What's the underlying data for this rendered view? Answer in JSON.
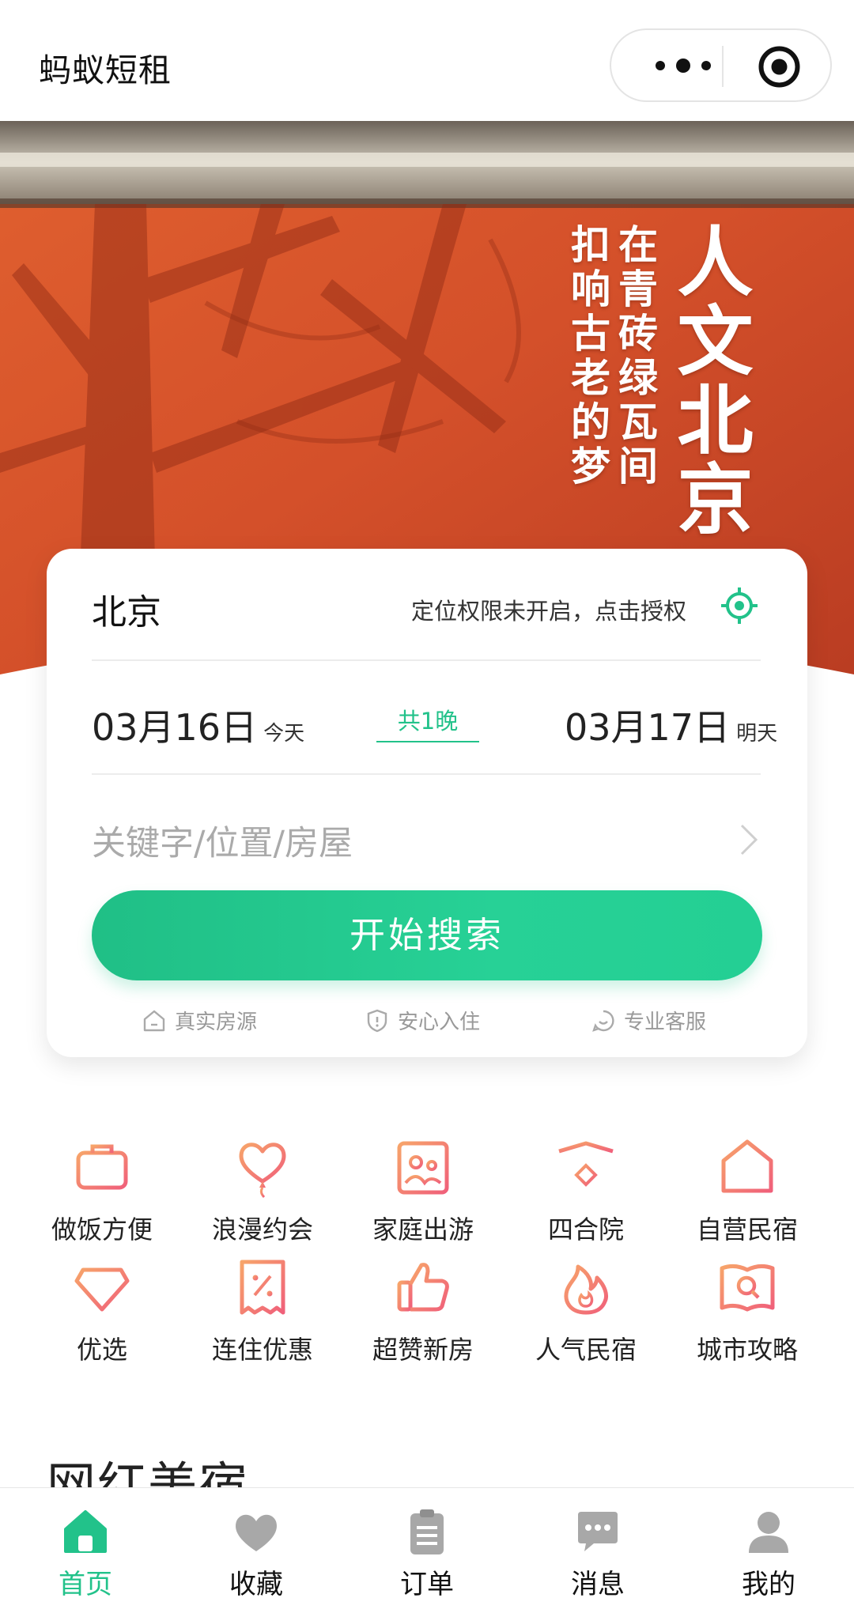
{
  "nav": {
    "title": "蚂蚁短租"
  },
  "banner": {
    "headline": "人文北京",
    "line1": "在青砖绿瓦间",
    "line2": "扣响古老的梦"
  },
  "search": {
    "city": "北京",
    "locate_hint": "定位权限未开启，点击授权",
    "checkin_date": "03月16日",
    "checkin_tag": "今天",
    "nights": "共1晚",
    "checkout_date": "03月17日",
    "checkout_tag": "明天",
    "keyword_placeholder": "关键字/位置/房屋",
    "search_button": "开始搜索",
    "assurances": [
      "真实房源",
      "安心入住",
      "专业客服"
    ]
  },
  "categories": [
    {
      "label": "做饭方便",
      "icon": "cooking-bag-icon"
    },
    {
      "label": "浪漫约会",
      "icon": "heart-balloon-icon"
    },
    {
      "label": "家庭出游",
      "icon": "family-photo-icon"
    },
    {
      "label": "四合院",
      "icon": "courtyard-gate-icon"
    },
    {
      "label": "自营民宿",
      "icon": "house-t-icon"
    },
    {
      "label": "优选",
      "icon": "diamond-icon"
    },
    {
      "label": "连住优惠",
      "icon": "discount-coupon-icon"
    },
    {
      "label": "超赞新房",
      "icon": "thumbs-up-icon"
    },
    {
      "label": "人气民宿",
      "icon": "flame-icon"
    },
    {
      "label": "城市攻略",
      "icon": "book-search-icon"
    }
  ],
  "section": {
    "title": "网红美宿"
  },
  "tabbar": [
    {
      "label": "首页",
      "icon": "home-icon",
      "active": true
    },
    {
      "label": "收藏",
      "icon": "heart-icon",
      "active": false
    },
    {
      "label": "订单",
      "icon": "clipboard-icon",
      "active": false
    },
    {
      "label": "消息",
      "icon": "chat-bubble-icon",
      "active": false
    },
    {
      "label": "我的",
      "icon": "user-icon",
      "active": false
    }
  ],
  "colors": {
    "accent": "#22c28a",
    "icon_gradient_start": "#f7a46a",
    "icon_gradient_end": "#f0607a",
    "banner_wall": "#d9512a",
    "tab_inactive": "#a8a8a8"
  }
}
